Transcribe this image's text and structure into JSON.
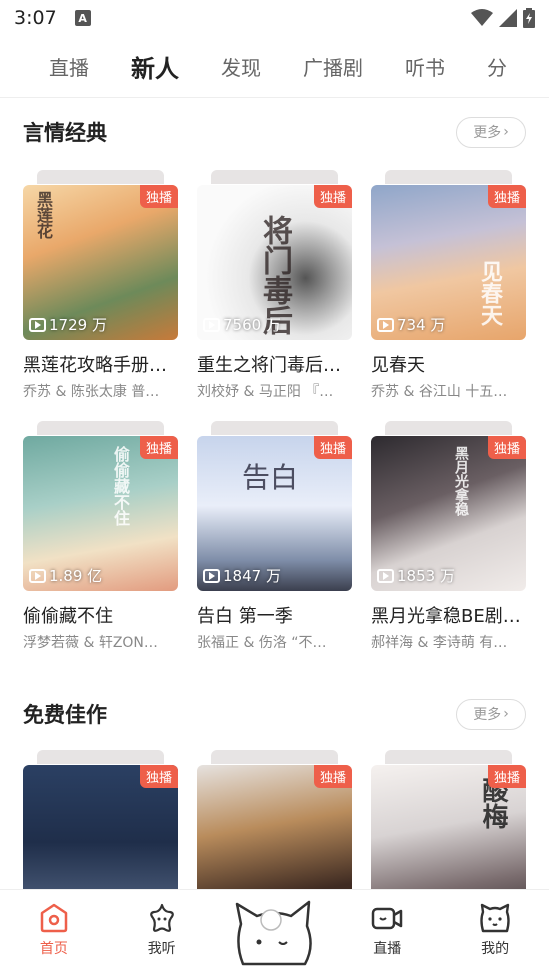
{
  "status": {
    "time": "3:07",
    "a_label": "A"
  },
  "tabs": [
    {
      "label": "直播",
      "active": false
    },
    {
      "label": "新人",
      "active": true
    },
    {
      "label": "发现",
      "active": false
    },
    {
      "label": "广播剧",
      "active": false
    },
    {
      "label": "听书",
      "active": false
    },
    {
      "label": "分",
      "active": false
    }
  ],
  "sections": [
    {
      "title": "言情经典",
      "more": "更多",
      "items": [
        {
          "title": "黑莲花攻略手册…",
          "sub": "乔苏 & 陈张太康 普…",
          "plays": "1729 万",
          "badge": "独播"
        },
        {
          "title": "重生之将门毒后…",
          "sub": "刘校妤 & 马正阳 『…",
          "plays": "7560 万",
          "badge": "独播"
        },
        {
          "title": "见春天",
          "sub": "乔苏 & 谷江山 十五…",
          "plays": "734 万",
          "badge": "独播"
        },
        {
          "title": "偷偷藏不住",
          "sub": "浮梦若薇 & 轩ZON…",
          "plays": "1.89 亿",
          "badge": "独播"
        },
        {
          "title": "告白 第一季",
          "sub": "张福正 & 伤洛 “不…",
          "plays": "1847 万",
          "badge": "独播"
        },
        {
          "title": "黑月光拿稳BE剧…",
          "sub": "郝祥海 & 李诗萌 有…",
          "plays": "1853 万",
          "badge": "独播"
        }
      ]
    },
    {
      "title": "免费佳作",
      "more": "更多",
      "items": [
        {
          "badge": "独播"
        },
        {
          "badge": "独播"
        },
        {
          "badge": "独播"
        }
      ]
    }
  ],
  "bottom_nav": [
    {
      "label": "首页",
      "icon": "home-icon",
      "active": true
    },
    {
      "label": "我听",
      "icon": "star-icon",
      "active": false
    },
    {
      "label": "",
      "icon": "cat-mascot-icon",
      "active": false
    },
    {
      "label": "直播",
      "icon": "video-camera-icon",
      "active": false
    },
    {
      "label": "我的",
      "icon": "cat-face-icon",
      "active": false
    }
  ],
  "colors": {
    "accent": "#ee5f4a",
    "badge": "#ee5f4a"
  }
}
